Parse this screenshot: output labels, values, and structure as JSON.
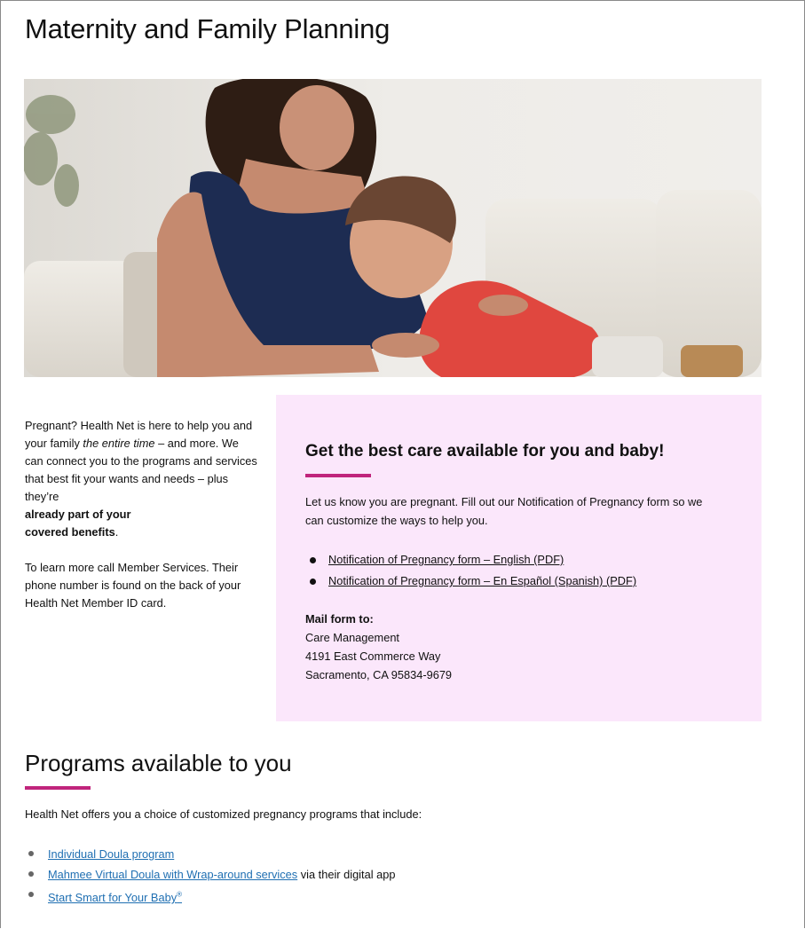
{
  "page": {
    "title": "Maternity and Family Planning"
  },
  "hero_image": {
    "icon": "photo-mother-and-child"
  },
  "intro": {
    "p1_part1": "Pregnant? Health Net is here to help you and your family ",
    "p1_italic": "the entire time",
    "p1_part2": " – and more. We can connect you to the programs and services that best fit your wants and needs – plus they’re ",
    "p1_bold1": "already part of your",
    "p1_bold2": "covered benefits",
    "p1_end": ".",
    "p2": "To learn more call Member Services. Their phone number is found on the back of your Health Net Member ID card."
  },
  "callout": {
    "heading": "Get the best care available for you and baby!",
    "lead": "Let us know you are pregnant. Fill out our Notification of Pregnancy form so we can customize the ways to help you.",
    "links": [
      "Notification of Pregnancy form – English (PDF)",
      "Notification of Pregnancy form – En Español (Spanish) (PDF)"
    ],
    "mail_heading": "Mail form to:",
    "address": [
      "Care Management",
      "4191 East Commerce Way",
      "Sacramento, CA 95834-9679"
    ],
    "accent_color": "#c0247c",
    "background_color": "#fbe7fb"
  },
  "programs": {
    "title": "Programs available to you",
    "lead": "Health Net offers you a choice of customized pregnancy programs that include:",
    "items": [
      {
        "link": "Individual Doula program",
        "suffix": ""
      },
      {
        "link": "Mahmee Virtual Doula with Wrap-around services",
        "suffix": " via their digital app"
      },
      {
        "link": "Start Smart for Your Baby",
        "suffix": "",
        "sup": "®"
      }
    ],
    "link_color": "#1f6fb2"
  }
}
